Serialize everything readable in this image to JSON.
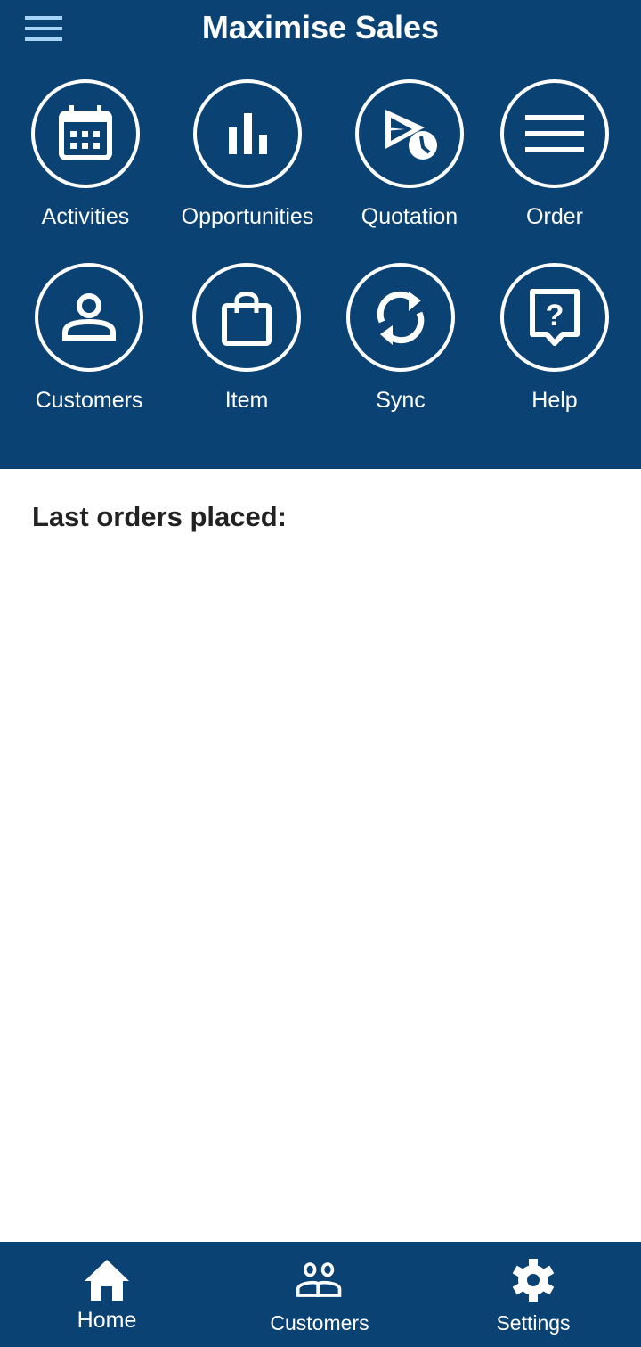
{
  "header": {
    "title": "Maximise Sales"
  },
  "tiles": [
    {
      "label": "Activities",
      "icon": "calendar-icon"
    },
    {
      "label": "Opportunities",
      "icon": "bar-chart-icon"
    },
    {
      "label": "Quotation",
      "icon": "send-clock-icon"
    },
    {
      "label": "Order",
      "icon": "list-icon"
    },
    {
      "label": "Customers",
      "icon": "person-icon"
    },
    {
      "label": "Item",
      "icon": "shopping-bag-icon"
    },
    {
      "label": "Sync",
      "icon": "sync-icon"
    },
    {
      "label": "Help",
      "icon": "help-icon"
    }
  ],
  "main": {
    "section_title": "Last orders placed:"
  },
  "nav": [
    {
      "label": "Home",
      "icon": "home-icon"
    },
    {
      "label": "Customers",
      "icon": "people-icon"
    },
    {
      "label": "Settings",
      "icon": "gear-icon"
    }
  ],
  "colors": {
    "primary": "#0b4274",
    "menu_icon": "#a8d4f5"
  }
}
